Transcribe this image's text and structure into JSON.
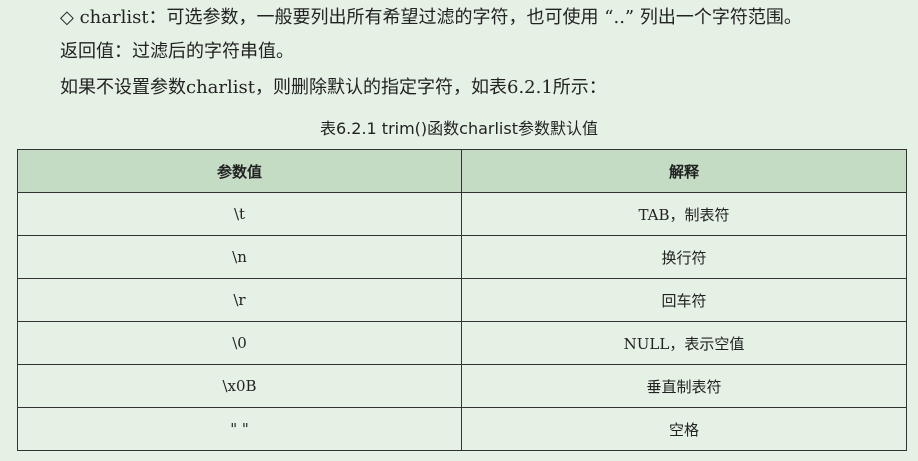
{
  "paragraphs": {
    "charlist_desc": "◇ charlist：可选参数，一般要列出所有希望过滤的字符，也可使用 “..” 列出一个字符范围。",
    "return_value": "返回值：过滤后的字符串值。",
    "default_note": "如果不设置参数charlist，则删除默认的指定字符，如表6.2.1所示："
  },
  "table": {
    "caption": "表6.2.1    trim()函数charlist参数默认值",
    "headers": [
      "参数值",
      "解释"
    ],
    "rows": [
      [
        "\\t",
        "TAB，制表符"
      ],
      [
        "\\n",
        "换行符"
      ],
      [
        "\\r",
        "回车符"
      ],
      [
        "\\0",
        "NULL，表示空值"
      ],
      [
        "\\x0B",
        "垂直制表符"
      ],
      [
        "\" \"",
        "空格"
      ]
    ]
  }
}
